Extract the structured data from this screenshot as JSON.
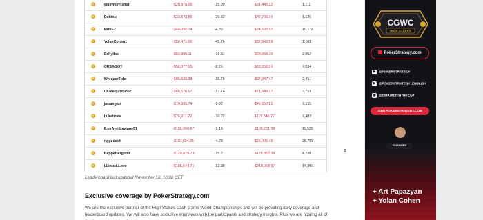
{
  "leaderboard": {
    "rows": [
      {
        "name": "yourmomishot",
        "pnl": "-$28,876.00",
        "pct": "-25.99",
        "total": "-$31,440.32",
        "hands": "1,111"
      },
      {
        "name": "Doblou",
        "pnl": "-$33,573.89",
        "pct": "-29.82",
        "total": "-$42,739.30",
        "hands": "1,126"
      },
      {
        "name": "MunEZ",
        "pnl": "-$44,056.74",
        "pct": "-4.33",
        "total": "-$74,593.97",
        "hands": "10,178"
      },
      {
        "name": "YolanCohen1",
        "pnl": "-$50,471.00",
        "pct": "-45.76",
        "total": "-$52,942.59",
        "hands": "1,103"
      },
      {
        "name": "Schyllae",
        "pnl": "-$52,988.11",
        "pct": "-18.51",
        "total": "-$68,068.10",
        "hands": "2,862"
      },
      {
        "name": "GREAGGY",
        "pnl": "-$58,077.05",
        "pct": "-8.26",
        "total": "-$63,358.81",
        "hands": "7,034"
      },
      {
        "name": "WhisperTide",
        "pnl": "-$65,633.38",
        "pct": "-26.78",
        "total": "-$92,947.47",
        "hands": "2,451"
      },
      {
        "name": "DKaladjurdjevic",
        "pnl": "-$66,576.17",
        "pct": "-17.74",
        "total": "-$71,549.17",
        "hands": "3,753"
      },
      {
        "name": "jasamgale",
        "pnl": "-$70,986.74",
        "pct": "-9.92",
        "total": "-$49,650.21",
        "hands": "7,155"
      },
      {
        "name": "Lukabrate",
        "pnl": "-$76,911.22",
        "pct": "-10.22",
        "total": "-$119,346.77",
        "hands": "7,483"
      },
      {
        "name": "ILuvAvrilLavigne91",
        "pnl": "-$106,060.67",
        "pct": "-9.19",
        "total": "-$106,221.36",
        "hands": "11,535"
      },
      {
        "name": "riggedeck",
        "pnl": "-$110,694.85",
        "pct": "-4.29",
        "total": "-$26,005.45",
        "hands": "25,788"
      },
      {
        "name": "BeppeBergomi",
        "pnl": "-$120,679.73",
        "pct": "-25.2",
        "total": "-$126,852.33",
        "hands": "4,788"
      },
      {
        "name": "LLinusLLove",
        "pnl": "-$185,644.71",
        "pct": "-12.38",
        "total": "-$240,068.97",
        "hands": "14,990"
      }
    ],
    "updated": "Leaderboard last updated November 18, 10:00 CET"
  },
  "article": {
    "heading": "Exclusive coverage by PokerStrategy.com",
    "paragraph": "We are the exclusive partner of the High Stakes Cash Game World Championships and will be providing daily coverage and leaderboard updates. We will also have exclusive interviews with the participants and strategy insights. Plus we are hosting all of the live streams from the event!"
  },
  "ad": {
    "badge_top": "CGWC",
    "badge_bottom": "HIGH STAKES",
    "site_button": "PokerStrategy.com",
    "socials": [
      {
        "icon": "youtube-icon",
        "label": "@POKERSTRATEGY"
      },
      {
        "icon": "youtube-icon",
        "label": "@POKERSTRATEGY_ENGLISH"
      },
      {
        "icon": "instagram-icon",
        "label": "@ENPOKERSTRATEGY"
      }
    ],
    "join_button": "JOIN POKERSTRATEGY.COM",
    "streamer": "YOANMERO",
    "promo_line1": "+ Art Papazyan",
    "promo_line2": "+ Yolan Cohen",
    "colors": {
      "accent": "#d8283a",
      "background": "#121217",
      "gold": "#d9a532"
    }
  }
}
